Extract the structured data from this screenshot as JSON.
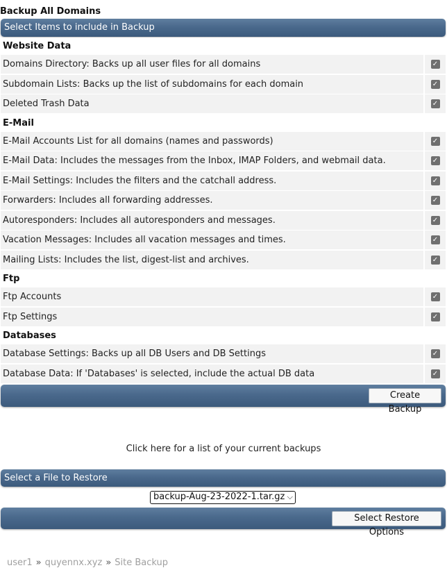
{
  "page_title": "Backup All Domains",
  "select_header": "Select Items to include in Backup",
  "sections": [
    {
      "title": "Website Data",
      "items": [
        "Domains Directory: Backs up all user files for all domains",
        "Subdomain Lists: Backs up the list of subdomains for each domain",
        "Deleted Trash Data"
      ]
    },
    {
      "title": "E-Mail",
      "items": [
        "E-Mail Accounts List for all domains (names and passwords)",
        "E-Mail Data: Includes the messages from the Inbox, IMAP Folders, and webmail data.",
        "E-Mail Settings: Includes the filters and the catchall address.",
        "Forwarders: Includes all forwarding addresses.",
        "Autoresponders: Includes all autoresponders and messages.",
        "Vacation Messages: Includes all vacation messages and times.",
        "Mailing Lists: Includes the list, digest-list and archives."
      ]
    },
    {
      "title": "Ftp",
      "items": [
        "Ftp Accounts",
        "Ftp Settings"
      ]
    },
    {
      "title": "Databases",
      "items": [
        "Database Settings: Backs up all DB Users and DB Settings",
        "Database Data: If 'Databases' is selected, include the actual DB data"
      ]
    }
  ],
  "checkbox_glyph": "✓",
  "create_button": "Create Backup",
  "backups_link": "Click here for a list of your current backups",
  "restore_header": "Select a File to Restore",
  "restore_file": "backup-Aug-23-2022-1.tar.gz",
  "restore_button": "Select Restore Options",
  "breadcrumb": [
    "user1",
    "quyennx.xyz",
    "Site Backup"
  ],
  "colors": {
    "bar": "#4a698c",
    "row": "#f2f2f2",
    "checkbox": "#6f6f6f"
  }
}
